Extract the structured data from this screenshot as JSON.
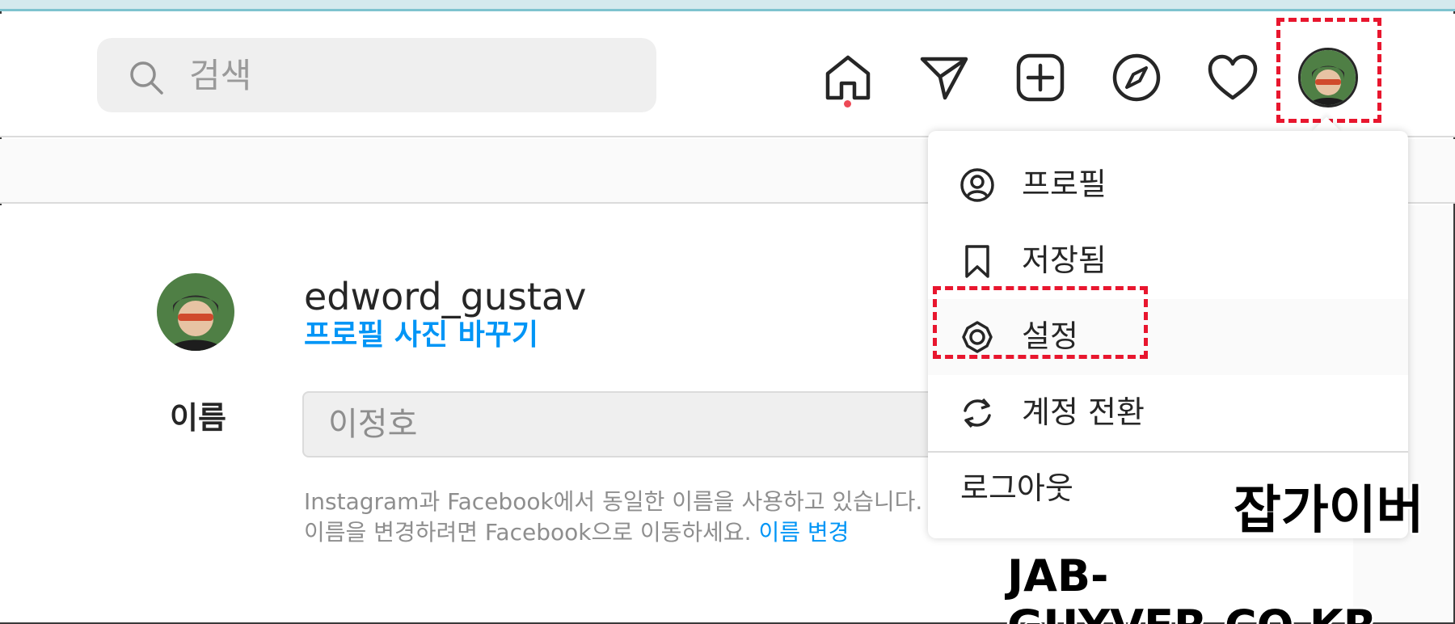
{
  "search": {
    "placeholder": "검색"
  },
  "colors": {
    "accent": "#0095f6",
    "highlight": "#e8162e",
    "notification": "#ed4956"
  },
  "nav": {
    "icons": [
      "home-icon",
      "direct-message-icon",
      "new-post-icon",
      "explore-icon",
      "activity-heart-icon",
      "profile-avatar"
    ]
  },
  "profile": {
    "username": "edword_gustav",
    "change_photo": "프로필 사진 바꾸기",
    "name_label": "이름",
    "name_value": "이정호",
    "help_text": "Instagram과 Facebook에서 동일한 이름을 사용하고 있습니다. 이름을 변경하려면 Facebook으로 이동하세요.",
    "help_link": "이름 변경"
  },
  "menu": {
    "items": [
      {
        "label": "프로필",
        "icon": "profile-circle-icon"
      },
      {
        "label": "저장됨",
        "icon": "bookmark-icon"
      },
      {
        "label": "설정",
        "icon": "settings-gear-icon"
      },
      {
        "label": "계정 전환",
        "icon": "switch-account-icon"
      }
    ],
    "logout": "로그아웃"
  },
  "watermark": {
    "ko": "잡가이버",
    "en": "JAB-GUYVER.CO.KR"
  }
}
